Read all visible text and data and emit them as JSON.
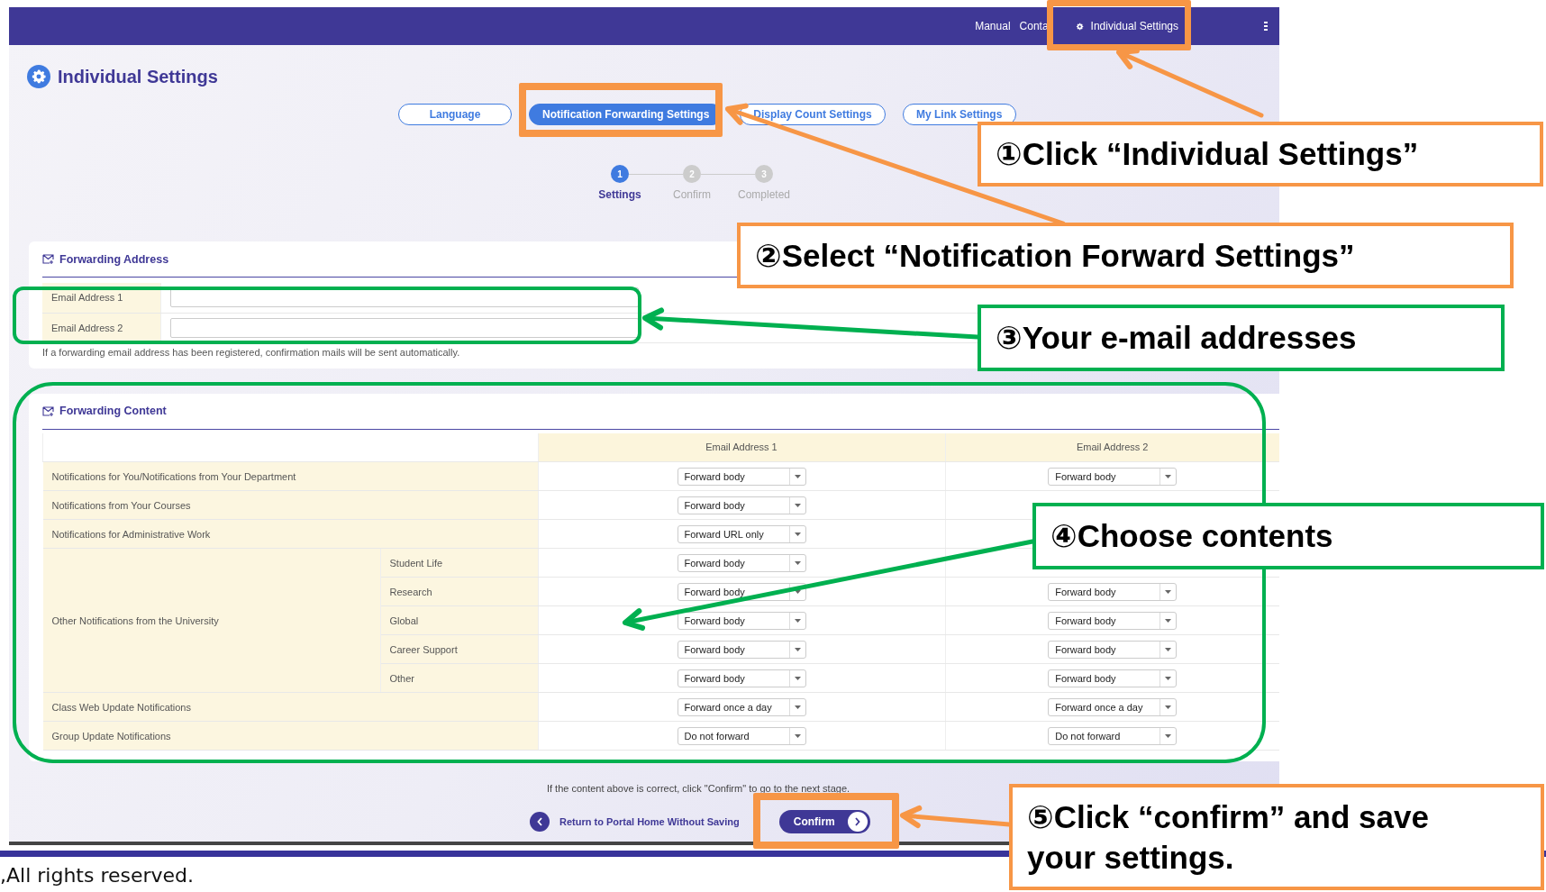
{
  "nav": {
    "links": [
      {
        "label": "Manual",
        "kind": "text"
      },
      {
        "label": "Conta",
        "kind": "text"
      },
      {
        "label": "Individual Settings",
        "kind": "settings"
      }
    ]
  },
  "page_title": "Individual Settings",
  "tabs": [
    {
      "label": "Language",
      "selected": false
    },
    {
      "label": "Notification Forwarding Settings",
      "selected": true
    },
    {
      "label": "Display Count Settings",
      "selected": false
    },
    {
      "label": "My Link Settings",
      "selected": false
    }
  ],
  "steps": [
    {
      "number": "1",
      "label": "Settings",
      "selected": true
    },
    {
      "number": "2",
      "label": "Confirm",
      "selected": false
    },
    {
      "number": "3",
      "label": "Completed",
      "selected": false
    }
  ],
  "forwarding_address": {
    "title": "Forwarding Address",
    "fields": [
      {
        "label": "Email Address 1"
      },
      {
        "label": "Email Address 2"
      }
    ],
    "note": "If a forwarding email address has been registered, confirmation mails will be sent automatically."
  },
  "forwarding_content": {
    "title": "Forwarding Content",
    "columns": [
      "Email Address 1",
      "Email Address 2"
    ],
    "rows": [
      {
        "label": "Notifications for You/Notifications from Your Department",
        "email_1": "Forward body",
        "email_2": "Forward body"
      },
      {
        "label": "Notifications from Your Courses",
        "email_1": "Forward body"
      },
      {
        "label": "Notifications for Administrative Work",
        "email_1": "Forward URL only"
      },
      {
        "label": "Other Notifications from the University",
        "children": [
          {
            "label": "Student Life",
            "email_1": "Forward body"
          },
          {
            "label": "Research",
            "email_1": "Forward body",
            "email_2": "Forward body"
          },
          {
            "label": "Global",
            "email_1": "Forward body",
            "email_2": "Forward body"
          },
          {
            "label": "Career Support",
            "email_1": "Forward body",
            "email_2": "Forward body"
          },
          {
            "label": "Other",
            "email_1": "Forward body",
            "email_2": "Forward body"
          }
        ]
      },
      {
        "label": "Class Web Update Notifications",
        "email_1": "Forward once a day",
        "email_2": "Forward once a day"
      },
      {
        "label": "Group Update Notifications",
        "email_1": "Do not forward",
        "email_2": "Do not forward"
      }
    ]
  },
  "confirm_note": "If the content above is correct, click \"Confirm\" to go to the next stage.",
  "return_link": "Return to Portal Home Without Saving",
  "confirm_button": "Confirm",
  "footer": ",All rights reserved.",
  "annotations": [
    {
      "text": "①Click “Individual Settings”",
      "color": "#f79646"
    },
    {
      "text": "②Select “Notification Forward Settings”",
      "color": "#f79646"
    },
    {
      "text": "③Your e-mail addresses",
      "color": "#00b050"
    },
    {
      "text": "④Choose contents",
      "color": "#00b050"
    },
    {
      "text": "⑤Click “confirm” and save your settings.",
      "color": "#f79646"
    }
  ]
}
